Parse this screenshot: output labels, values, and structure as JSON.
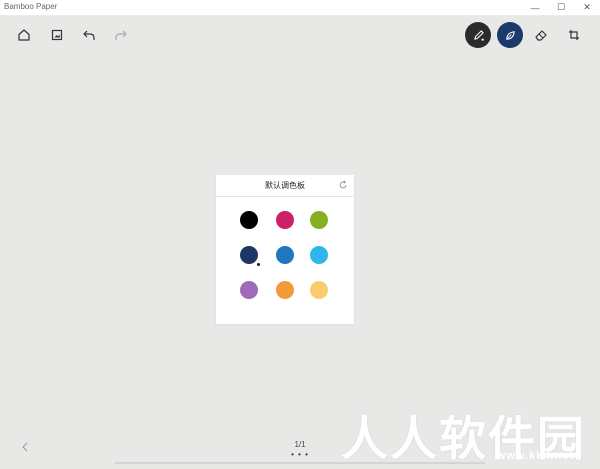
{
  "window": {
    "title": "Bamboo Paper",
    "controls": [
      "minimize-icon",
      "maximize-icon",
      "close-icon"
    ]
  },
  "toolbar": {
    "left_icons": [
      "home-icon",
      "image-icon",
      "undo-icon",
      "redo-icon"
    ],
    "right_icons": [
      "pen-icon",
      "brush-icon",
      "eraser-icon",
      "crop-icon"
    ],
    "active_pen_color": "#2b2b2b",
    "active_brush_color": "#1a3a6b"
  },
  "palette": {
    "title": "默认调色板",
    "reset_icon": "refresh-icon",
    "colors": [
      "#000000",
      "#c9216a",
      "#86b020",
      "#1c3766",
      "#1f78bf",
      "#2fb6ea",
      "#9e6bb7",
      "#f39a38",
      "#fbcc6e"
    ],
    "selected_index": 3
  },
  "pager": {
    "text": "1/1",
    "dots": "• • •",
    "prev_icon": "chevron-left-icon"
  },
  "watermark": {
    "text": "人人软件园",
    "sub": "www.kkx.net"
  }
}
